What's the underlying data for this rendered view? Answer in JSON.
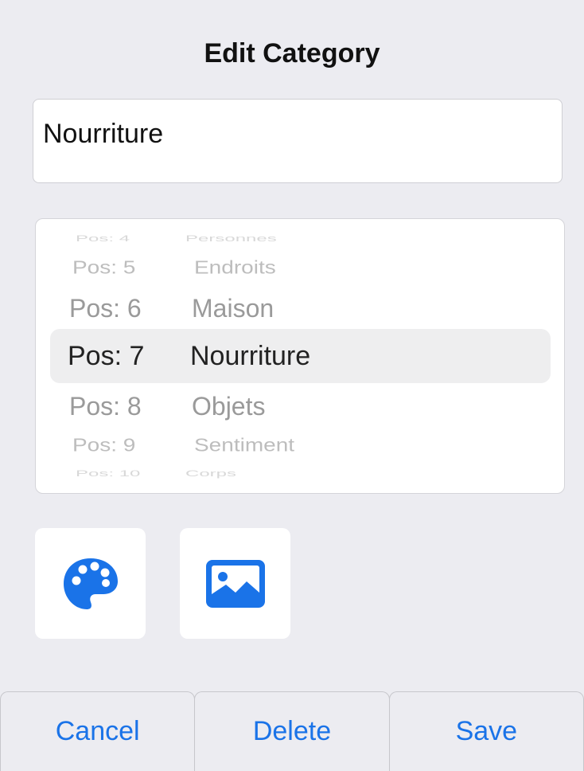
{
  "dialog": {
    "title": "Edit Category",
    "name_field": {
      "value": "Nourriture",
      "placeholder": ""
    }
  },
  "picker": {
    "rows": [
      {
        "pos": "Pos: 4",
        "label": "Personnes"
      },
      {
        "pos": "Pos: 5",
        "label": "Endroits"
      },
      {
        "pos": "Pos: 6",
        "label": "Maison"
      },
      {
        "pos": "Pos: 7",
        "label": "Nourriture"
      },
      {
        "pos": "Pos: 8",
        "label": "Objets"
      },
      {
        "pos": "Pos: 9",
        "label": "Sentiment"
      },
      {
        "pos": "Pos: 10",
        "label": "Corps"
      }
    ],
    "selected_index": 3
  },
  "tools": {
    "palette_icon": "palette-icon",
    "image_icon": "photo-icon",
    "accent": "#1a73e8"
  },
  "actions": {
    "cancel_label": "Cancel",
    "delete_label": "Delete",
    "save_label": "Save"
  }
}
